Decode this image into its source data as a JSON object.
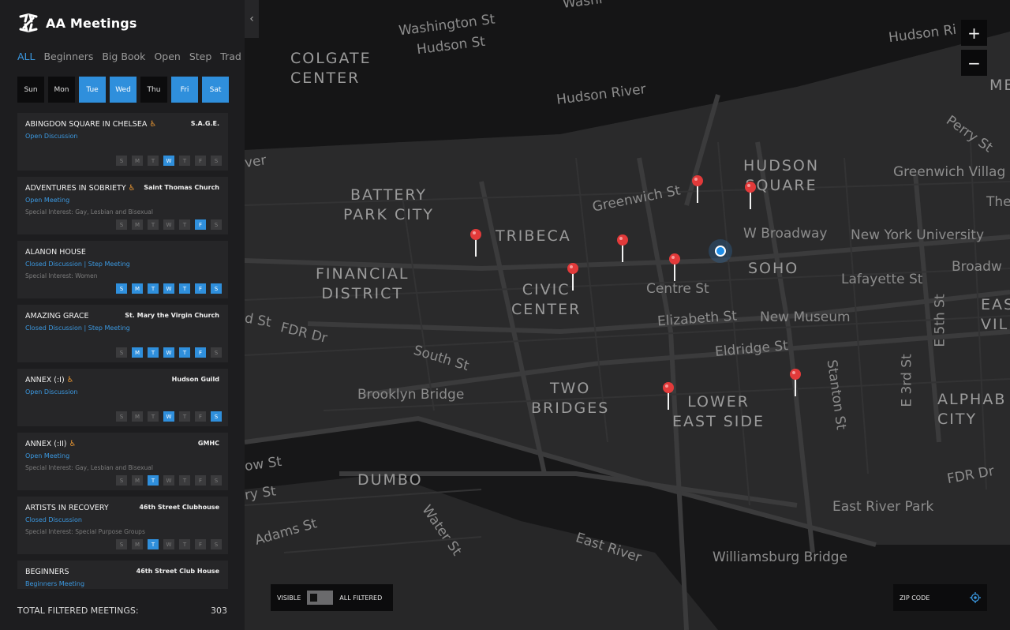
{
  "app": {
    "title": "AA Meetings"
  },
  "tabs": [
    "ALL",
    "Beginners",
    "Big Book",
    "Open",
    "Step",
    "Trad"
  ],
  "days": [
    {
      "label": "Sun",
      "on": false
    },
    {
      "label": "Mon",
      "on": false
    },
    {
      "label": "Tue",
      "on": true
    },
    {
      "label": "Wed",
      "on": true
    },
    {
      "label": "Thu",
      "on": false
    },
    {
      "label": "Fri",
      "on": true
    },
    {
      "label": "Sat",
      "on": true
    }
  ],
  "week_letters": [
    "S",
    "M",
    "T",
    "W",
    "T",
    "F",
    "S"
  ],
  "meetings": [
    {
      "name": "ABINGDON SQUARE IN CHELSEA",
      "wheelchair": true,
      "location": "S.A.G.E.",
      "type": "Open Discussion",
      "interest": "",
      "days": [
        false,
        false,
        false,
        true,
        false,
        false,
        false
      ]
    },
    {
      "name": "ADVENTURES IN SOBRIETY",
      "wheelchair": true,
      "location": "Saint Thomas Church",
      "type": "Open Meeting",
      "interest": "Special Interest: Gay, Lesbian and Bisexual",
      "days": [
        false,
        false,
        false,
        false,
        false,
        true,
        false
      ]
    },
    {
      "name": "ALANON HOUSE",
      "wheelchair": false,
      "location": "",
      "type": "Closed Discussion | Step Meeting",
      "interest": "Special Interest: Women",
      "days": [
        true,
        true,
        true,
        true,
        true,
        true,
        true
      ]
    },
    {
      "name": "AMAZING GRACE",
      "wheelchair": false,
      "location": "St. Mary the Virgin Church",
      "type": "Closed Discussion | Step Meeting",
      "interest": "",
      "days": [
        false,
        true,
        true,
        true,
        true,
        true,
        false
      ]
    },
    {
      "name": "ANNEX (:I)",
      "wheelchair": true,
      "location": "Hudson Guild",
      "type": "Open Discussion",
      "interest": "",
      "days": [
        false,
        false,
        false,
        true,
        false,
        false,
        true
      ]
    },
    {
      "name": "ANNEX (:II)",
      "wheelchair": true,
      "location": "GMHC",
      "type": "Open Meeting",
      "interest": "Special Interest: Gay, Lesbian and Bisexual",
      "days": [
        false,
        false,
        true,
        false,
        false,
        false,
        false
      ]
    },
    {
      "name": "ARTISTS IN RECOVERY",
      "wheelchair": false,
      "location": "46th Street Clubhouse",
      "type": "Closed Discussion",
      "interest": "Special Interest: Special Purpose Groups",
      "days": [
        false,
        false,
        true,
        false,
        false,
        false,
        false
      ]
    },
    {
      "name": "BEGINNERS",
      "wheelchair": false,
      "location": "46th Street Club House",
      "type": "Beginners Meeting",
      "interest": "",
      "days": [
        false,
        false,
        false,
        false,
        false,
        false,
        false
      ]
    }
  ],
  "footer": {
    "total_label": "TOTAL FILTERED MEETINGS:",
    "total_value": "303"
  },
  "map": {
    "zoom_in": "+",
    "zoom_out": "−",
    "toggle_left": "VISIBLE",
    "toggle_right": "ALL FILTERED",
    "zip_placeholder": "ZIP CODE",
    "labels": {
      "colgate": "COLGATE\nCENTER",
      "battery": "BATTERY\nPARK CITY",
      "tribeca": "TRIBECA",
      "financial": "FINANCIAL\nDISTRICT",
      "civic": "CIVIC\nCENTER",
      "hudson_sq": "HUDSON\nSQUARE",
      "soho": "SOHO",
      "two_bridges": "TWO\nBRIDGES",
      "les": "LOWER\nEAST SIDE",
      "dumbo": "DUMBO",
      "alphabet": "ALPHAB\nCITY",
      "east_vill": "EAS\nVILL",
      "me": "ME",
      "washington": "Washington St",
      "hudson_st": "Hudson St",
      "hudson_river": "Hudson River",
      "hudson_ri": "Hudson Ri",
      "perry": "Perry St",
      "greenwich": "Greenwich St",
      "greenwich_vil": "Greenwich Villag",
      "the": "The",
      "w_broadway": "W Broadway",
      "nyu": "New York University",
      "broadw": "Broadw",
      "lafayette": "Lafayette St",
      "centre": "Centre St",
      "elizabeth": "Elizabeth St",
      "new_museum": "New Museum",
      "eldridge": "Eldridge St",
      "e5th": "E 5th St",
      "e3rd": "E 3rd St",
      "stanton": "Stanton St",
      "fdr1": "FDR Dr",
      "fdr2": "FDR Dr",
      "south": "South St",
      "brooklyn": "Brooklyn Bridge",
      "water": "Water St",
      "adams": "Adams St",
      "east_river": "East River",
      "east_river_park": "East River Park",
      "williamsburg": "Williamsburg Bridge",
      "ow_st": "ow St",
      "ry_st": "ry St",
      "ver": "ver",
      "d_st": "d St",
      "washi": "Washi"
    }
  }
}
